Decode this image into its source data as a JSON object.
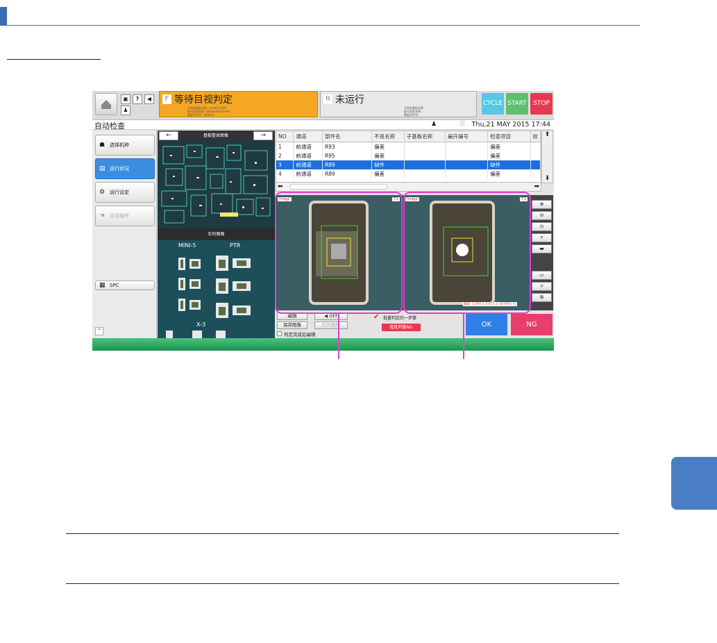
{
  "app": {
    "status_f": {
      "letter": "F",
      "title": "等待目视判定",
      "meta_lines": [
        "可判别基板名称 : product-001",
        "批号判别名称 : Nakdeline/frame",
        "基板序列号 : 000011"
      ]
    },
    "status_r": {
      "letter": "R",
      "title": "未运行",
      "meta_lines": [
        "可判别基板名称 :",
        "批号判别名称 :",
        "基板序列号 :"
      ]
    },
    "controls": [
      {
        "label": "CYCLE",
        "color": "#58c7e6"
      },
      {
        "label": "START",
        "color": "#5cc06e"
      },
      {
        "label": "STOP",
        "color": "#e8384f"
      }
    ],
    "subtitle": "自动检查",
    "datetime": "Thu,21 MAY 2015  17:44",
    "nav": [
      {
        "label": "选择机种",
        "icon": "☗"
      },
      {
        "label": "运行状况",
        "icon": "▤"
      },
      {
        "label": "运行设定",
        "icon": "⚙"
      },
      {
        "label": "手动操作",
        "icon": "☚"
      }
    ],
    "spc_label": "SPC",
    "board_title": "基板整体图像",
    "board_arrows": [
      "←",
      "→"
    ],
    "real_title": "实时图像",
    "real_labels": [
      "MINI-5",
      "PTR",
      "X-3"
    ],
    "table": {
      "headers": [
        "NO",
        "通道",
        "部件名",
        "不良名称",
        "子基板名称",
        "扁开编号",
        "检查项目",
        "校"
      ],
      "rows": [
        [
          "1",
          "前通道",
          "R93",
          "偏差",
          "",
          "",
          "偏差"
        ],
        [
          "2",
          "前通道",
          "R95",
          "偏差",
          "",
          "",
          "偏差"
        ],
        [
          "3",
          "前通道",
          "R89",
          "缺件",
          "",
          "",
          "缺件"
        ],
        [
          "4",
          "前通道",
          "R89",
          "偏差",
          "",
          "",
          "偏差"
        ]
      ]
    },
    "insp_tags": [
      "Image",
      "Image",
      "T.S",
      "T.S"
    ],
    "measure_text": "偏差: 1.000 ≠ 0.875 ≠ 20.000 [ %",
    "bottom": {
      "edit": "编辑",
      "save_image": "保存图像",
      "mute": "OFF",
      "disabled_btn": "打开图像",
      "batch_label": "批量判定的一步骤",
      "batch_ng": "批批判量NG",
      "after_edit": "判定完成后编辑"
    },
    "ok": "OK",
    "ng": "NG"
  }
}
